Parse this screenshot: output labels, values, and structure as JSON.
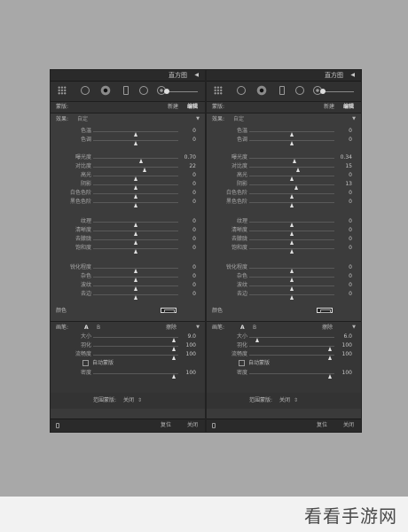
{
  "panels": [
    {
      "id": "left",
      "header": {
        "title": "直方图"
      },
      "mask": {
        "label": "蒙版:",
        "new_label": "新建",
        "edit_label": "编辑"
      },
      "effect": {
        "label": "效果:",
        "value": "自定"
      },
      "sliders": [
        {
          "label": "色温",
          "value": "0",
          "pos": 0.5
        },
        {
          "label": "色调",
          "value": "0",
          "pos": 0.5
        },
        {
          "label": "曝光度",
          "value": "0.70",
          "pos": 0.57
        },
        {
          "label": "对比度",
          "value": "22",
          "pos": 0.61
        },
        {
          "label": "高光",
          "value": "0",
          "pos": 0.5
        },
        {
          "label": "阴影",
          "value": "0",
          "pos": 0.5
        },
        {
          "label": "白色色阶",
          "value": "0",
          "pos": 0.5
        },
        {
          "label": "黑色色阶",
          "value": "0",
          "pos": 0.5
        },
        {
          "label": "纹理",
          "value": "0",
          "pos": 0.5
        },
        {
          "label": "清晰度",
          "value": "0",
          "pos": 0.5
        },
        {
          "label": "去朦胧",
          "value": "0",
          "pos": 0.5
        },
        {
          "label": "饱和度",
          "value": "0",
          "pos": 0.5
        },
        {
          "label": "锐化程度",
          "value": "0",
          "pos": 0.5
        },
        {
          "label": "杂色",
          "value": "0",
          "pos": 0.5
        },
        {
          "label": "波纹",
          "value": "0",
          "pos": 0.5
        },
        {
          "label": "去边",
          "value": "0",
          "pos": 0.5
        }
      ],
      "color_label": "颜色",
      "brush": {
        "label": "画笔:",
        "a": "A",
        "b": "B",
        "erase": "擦除",
        "size_label": "大小",
        "size_value": "9.0",
        "size_pos": 0.95,
        "feather_label": "羽化",
        "feather_value": "100",
        "feather_pos": 0.95,
        "flow_label": "流畅度",
        "flow_value": "100",
        "flow_pos": 0.95,
        "auto_mask": "自动蒙版",
        "density_label": "密度",
        "density_value": "100",
        "density_pos": 0.95
      },
      "range_mask": {
        "label": "范围蒙版:",
        "value": "关闭"
      },
      "footer": {
        "reset": "复位",
        "close": "关闭"
      }
    },
    {
      "id": "right",
      "header": {
        "title": "直方图"
      },
      "mask": {
        "label": "蒙版:",
        "new_label": "新建",
        "edit_label": "编辑"
      },
      "effect": {
        "label": "效果:",
        "value": "自定"
      },
      "sliders": [
        {
          "label": "色温",
          "value": "0",
          "pos": 0.5
        },
        {
          "label": "色调",
          "value": "0",
          "pos": 0.5
        },
        {
          "label": "曝光度",
          "value": "0.34",
          "pos": 0.54
        },
        {
          "label": "对比度",
          "value": "15",
          "pos": 0.58
        },
        {
          "label": "高光",
          "value": "0",
          "pos": 0.5
        },
        {
          "label": "阴影",
          "value": "13",
          "pos": 0.56
        },
        {
          "label": "白色色阶",
          "value": "0",
          "pos": 0.5
        },
        {
          "label": "黑色色阶",
          "value": "0",
          "pos": 0.5
        },
        {
          "label": "纹理",
          "value": "0",
          "pos": 0.5
        },
        {
          "label": "清晰度",
          "value": "0",
          "pos": 0.5
        },
        {
          "label": "去朦胧",
          "value": "0",
          "pos": 0.5
        },
        {
          "label": "饱和度",
          "value": "0",
          "pos": 0.5
        },
        {
          "label": "锐化程度",
          "value": "0",
          "pos": 0.5
        },
        {
          "label": "杂色",
          "value": "0",
          "pos": 0.5
        },
        {
          "label": "波纹",
          "value": "0",
          "pos": 0.5
        },
        {
          "label": "去边",
          "value": "0",
          "pos": 0.5
        }
      ],
      "color_label": "颜色",
      "brush": {
        "label": "画笔:",
        "a": "A",
        "b": "B",
        "erase": "擦除",
        "size_label": "大小",
        "size_value": "6.0",
        "size_pos": 0.1,
        "feather_label": "羽化",
        "feather_value": "100",
        "feather_pos": 0.95,
        "flow_label": "流畅度",
        "flow_value": "100",
        "flow_pos": 0.95,
        "auto_mask": "自动蒙版",
        "density_label": "密度",
        "density_value": "100",
        "density_pos": 0.95
      },
      "range_mask": {
        "label": "范围蒙版:",
        "value": "关闭"
      },
      "footer": {
        "reset": "复位",
        "close": "关闭"
      }
    }
  ],
  "watermark": "看看手游网",
  "colors": {
    "panel_bg": "#3a3a3a",
    "page_bg": "#a8a8a8"
  }
}
